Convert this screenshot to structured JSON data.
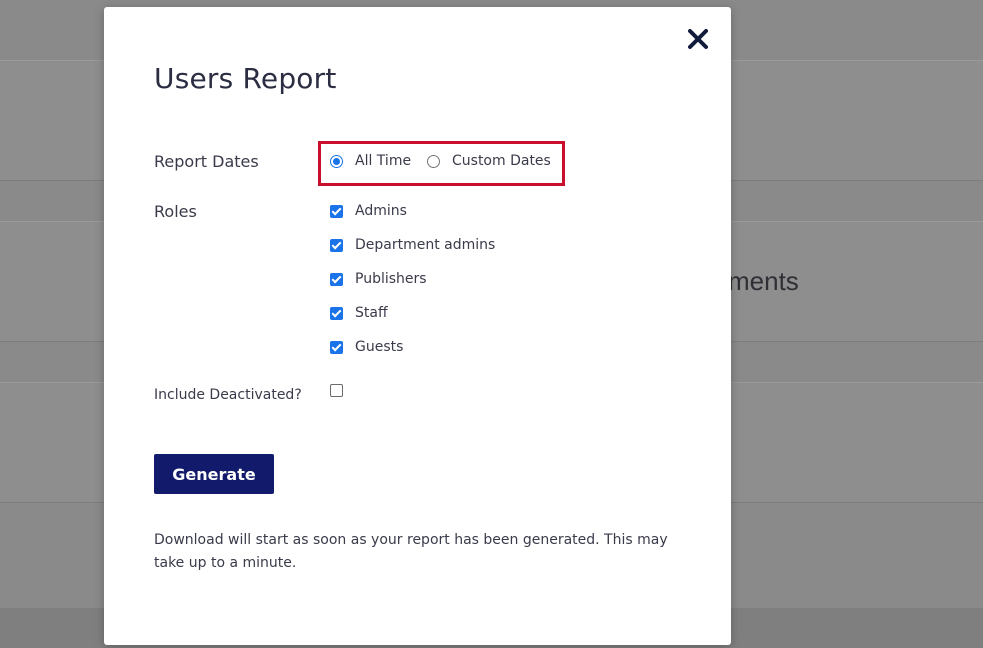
{
  "background": {
    "partial_text": "yments"
  },
  "modal": {
    "title": "Users Report",
    "close_icon": "close-icon",
    "report_dates": {
      "label": "Report Dates",
      "options": [
        {
          "label": "All Time",
          "selected": true
        },
        {
          "label": "Custom Dates",
          "selected": false
        }
      ]
    },
    "roles": {
      "label": "Roles",
      "items": [
        {
          "label": "Admins",
          "checked": true
        },
        {
          "label": "Department admins",
          "checked": true
        },
        {
          "label": "Publishers",
          "checked": true
        },
        {
          "label": "Staff",
          "checked": true
        },
        {
          "label": "Guests",
          "checked": true
        }
      ]
    },
    "include_deactivated": {
      "label": "Include Deactivated?",
      "checked": false
    },
    "generate_label": "Generate",
    "note": "Download will start as soon as your report has been generated. This may take up to a minute."
  },
  "colors": {
    "primary_button": "#121b6b",
    "highlight": "#c8102e",
    "control_accent": "#1a73e8"
  }
}
